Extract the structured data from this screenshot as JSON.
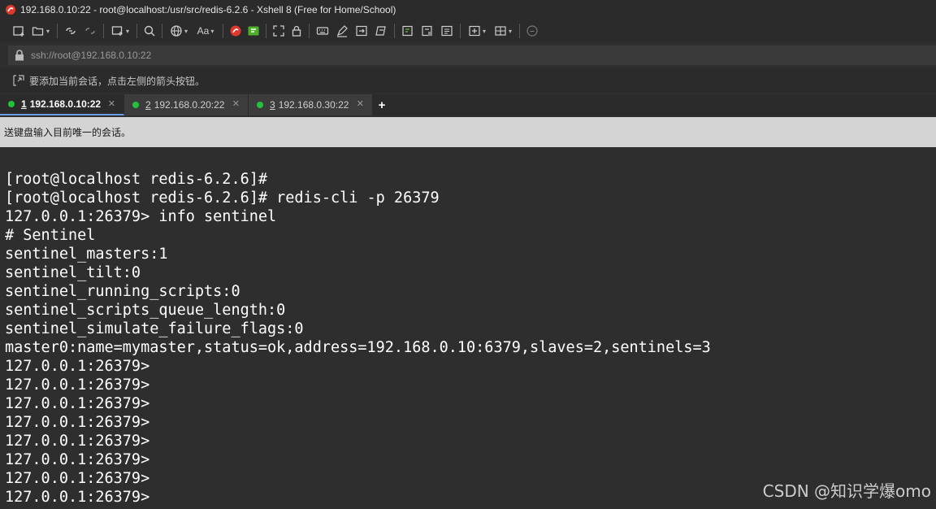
{
  "window": {
    "title": "192.168.0.10:22 - root@localhost:/usr/src/redis-6.2.6 - Xshell 8 (Free for Home/School)"
  },
  "toolbar": {
    "font_label": "Aa"
  },
  "address_bar": {
    "value": "ssh://root@192.168.0.10:22"
  },
  "hint_bar": {
    "text": "要添加当前会话，点击左侧的箭头按钮。"
  },
  "tabs": [
    {
      "number": "1",
      "label": "192.168.0.10:22",
      "status": "connected"
    },
    {
      "number": "2",
      "label": "192.168.0.20:22",
      "status": "connected"
    },
    {
      "number": "3",
      "label": "192.168.0.30:22",
      "status": "connected"
    }
  ],
  "tab_close_glyph": "✕",
  "tab_add_glyph": "+",
  "compose_bar": {
    "text": "送键盘输入目前唯一的会话。"
  },
  "terminal": {
    "lines": [
      "[root@localhost redis-6.2.6]#",
      "[root@localhost redis-6.2.6]# redis-cli -p 26379",
      "127.0.0.1:26379> info sentinel",
      "# Sentinel",
      "sentinel_masters:1",
      "sentinel_tilt:0",
      "sentinel_running_scripts:0",
      "sentinel_scripts_queue_length:0",
      "sentinel_simulate_failure_flags:0",
      "master0:name=mymaster,status=ok,address=192.168.0.10:6379,slaves=2,sentinels=3",
      "127.0.0.1:26379>",
      "127.0.0.1:26379>",
      "127.0.0.1:26379>",
      "127.0.0.1:26379>",
      "127.0.0.1:26379>",
      "127.0.0.1:26379>",
      "127.0.0.1:26379>",
      "127.0.0.1:26379>"
    ]
  },
  "watermark": {
    "text": "CSDN @知识学爆omo"
  },
  "colors": {
    "terminal_bg": "#2e2e2e",
    "terminal_fg": "#ffffff",
    "connected_dot": "#22c23c",
    "compose_bar_bg": "#d4d4d4"
  }
}
